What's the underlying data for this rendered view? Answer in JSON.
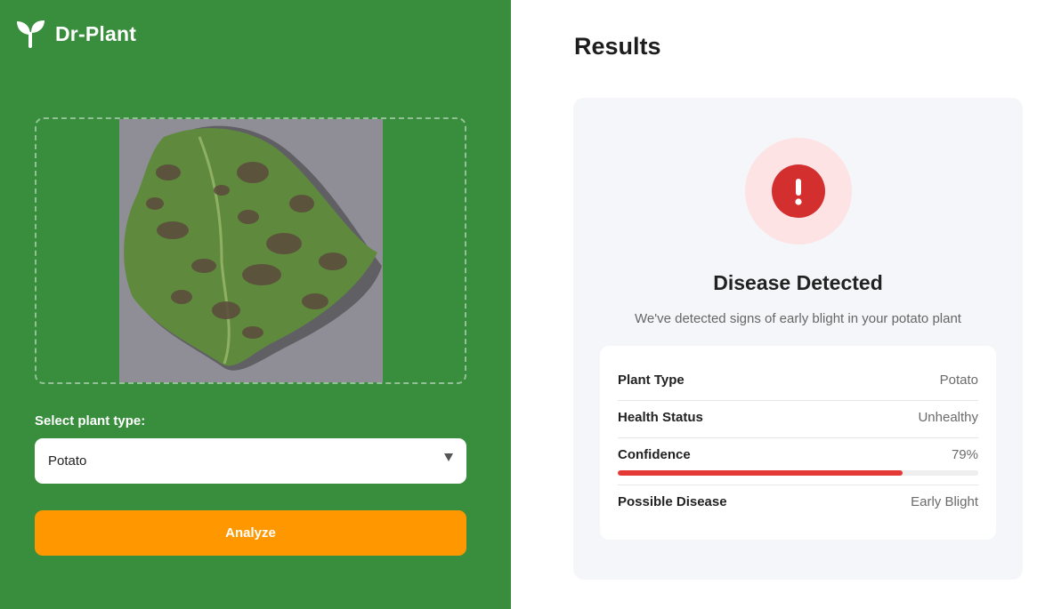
{
  "app": {
    "brand_name": "Dr-Plant",
    "brand_icon": "sprout-icon"
  },
  "upload": {
    "image_subject": "potato leaf photo"
  },
  "plant_select": {
    "label": "Select plant type:",
    "selected": "Potato",
    "caret_icon": "chevron-down-icon"
  },
  "analyze": {
    "label": "Analyze"
  },
  "results": {
    "title": "Results",
    "status_icon": "exclamation-icon",
    "status_title": "Disease Detected",
    "status_description": "We've detected signs of early blight in your potato plant",
    "details": [
      {
        "label": "Plant Type",
        "value": "Potato"
      },
      {
        "label": "Health Status",
        "value": "Unhealthy"
      },
      {
        "label": "Confidence",
        "value": "79%"
      },
      {
        "label": "Possible Disease",
        "value": "Early Blight"
      }
    ],
    "confidence_fraction": 0.79
  },
  "colors": {
    "sidebar_bg": "#388e3c",
    "accent_orange": "#ff9800",
    "alert_red": "#d32f2f",
    "alert_halo": "#fde3e4",
    "confidence_bar": "#e53935",
    "card_bg": "#f5f6f9"
  }
}
